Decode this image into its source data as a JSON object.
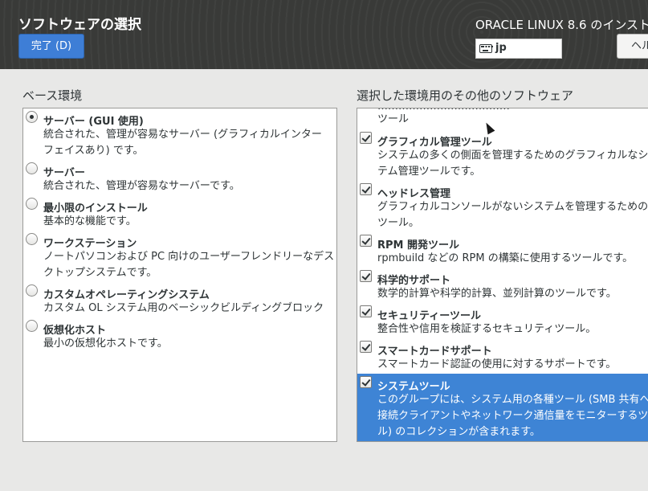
{
  "header": {
    "page_title": "ソフトウェアの選択",
    "done_label": "完了 (D)",
    "product_title": "ORACLE LINUX 8.6 のインスト",
    "keyboard_layout": "jp",
    "help_label": "ヘル"
  },
  "base_environment": {
    "label": "ベース環境",
    "selected": "サーバー (GUI 使用)",
    "items": [
      {
        "title": "サーバー (GUI 使用)",
        "desc": [
          "統合された、管理が容易なサーバー (グラフィカルインター",
          "フェイスあり) です。"
        ]
      },
      {
        "title": "サーバー",
        "desc": [
          "統合された、管理が容易なサーバーです。"
        ]
      },
      {
        "title": "最小限のインストール",
        "desc": [
          "基本的な機能です。"
        ]
      },
      {
        "title": "ワークステーション",
        "desc": [
          "ノートパソコンおよび PC 向けのユーザーフレンドリーなデス",
          "クトップシステムです。"
        ]
      },
      {
        "title": "カスタムオペレーティングシステム",
        "desc": [
          "カスタム OL システム用のベーシックビルディングブロック"
        ]
      },
      {
        "title": "仮想化ホスト",
        "desc": [
          "最小の仮想化ホストです。"
        ]
      }
    ]
  },
  "addons": {
    "label": "選択した環境用のその他のソフトウェア",
    "cut_prev_line": "ツール",
    "items": [
      {
        "title": "グラフィカル管理ツール",
        "checked": true,
        "desc": [
          "システムの多くの側面を管理するためのグラフィカルなシス",
          "テム管理ツールです。"
        ]
      },
      {
        "title": "ヘッドレス管理",
        "checked": true,
        "desc": [
          "グラフィカルコンソールがないシステムを管理するための",
          "ツール。"
        ]
      },
      {
        "title": "RPM 開発ツール",
        "checked": true,
        "desc": [
          "rpmbuild などの RPM の構築に使用するツールです。"
        ]
      },
      {
        "title": "科学的サポート",
        "checked": true,
        "desc": [
          "数学的計算や科学的計算、並列計算のツールです。"
        ]
      },
      {
        "title": "セキュリティーツール",
        "checked": true,
        "desc": [
          "整合性や信用を検証するセキュリティツール。"
        ]
      },
      {
        "title": "スマートカードサポート",
        "checked": true,
        "desc": [
          "スマートカード認証の使用に対するサポートです。"
        ]
      },
      {
        "title": "システムツール",
        "checked": true,
        "selected": true,
        "desc": [
          "このグループには、システム用の各種ツール (SMB 共有へ",
          "接続クライアントやネットワーク通信量をモニターするツー",
          "ル) のコレクションが含まれます。"
        ]
      }
    ]
  }
}
